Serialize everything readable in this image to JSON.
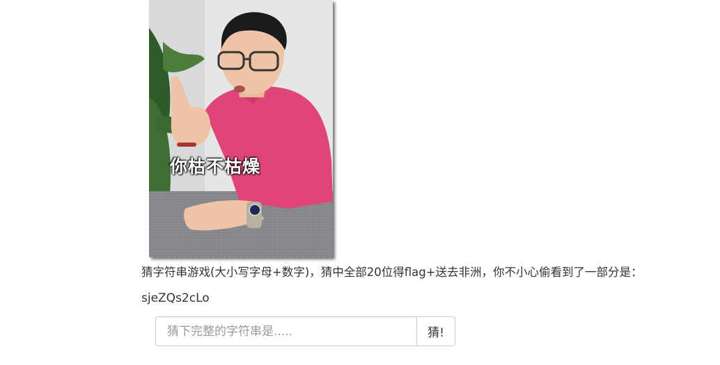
{
  "meme": {
    "caption": "你枯不枯燥"
  },
  "rules_text": "猜字符串游戏(大小写字母+数字)，猜中全部20位得flag+送去非洲，你不小心偷看到了一部分是：",
  "partial_string": "sjeZQs2cLo",
  "guess": {
    "placeholder": "猜下完整的字符串是.....",
    "value": "",
    "button_label": "猜!"
  },
  "colors": {
    "text": "#333333",
    "placeholder": "#999999",
    "border": "#cccccc",
    "shirt": "#e0457a"
  }
}
